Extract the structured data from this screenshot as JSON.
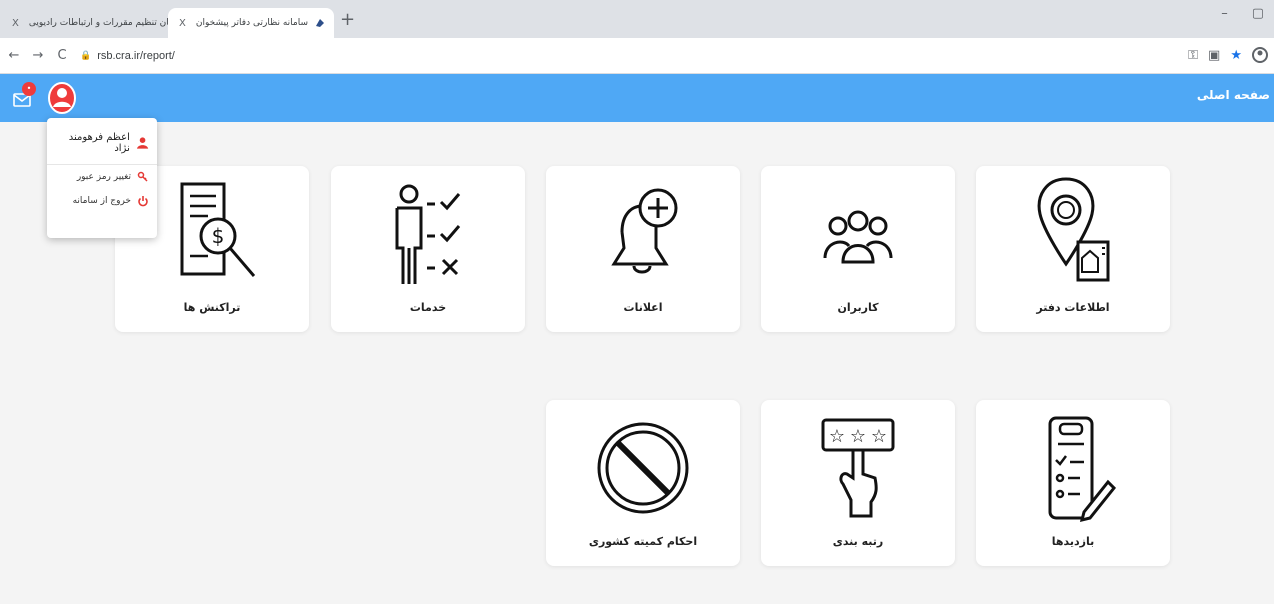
{
  "browser": {
    "tabs": [
      {
        "title": "سازمان تنظیم مقررات و ارتباطات رادیویی",
        "close": "X",
        "active": false
      },
      {
        "title": "سامانه نظارتی دفاتر پیشخوان",
        "close": "X",
        "active": true
      }
    ],
    "new_tab": "+",
    "window_controls": {
      "minimize": "–",
      "restore": "▢"
    },
    "url": "rsb.cra.ir/report/",
    "nav": {
      "back": "←",
      "forward": "→",
      "reload": "C"
    }
  },
  "appbar": {
    "home_label": "صفحه اصلی",
    "mail_badge": "•",
    "color": "#4fa8f5"
  },
  "user_menu": {
    "user_name": "اعظم فرهومند نژاد",
    "items": [
      {
        "label": "تغییر رمز عبور",
        "icon": "key-icon"
      },
      {
        "label": "خروج از سامانه",
        "icon": "power-icon"
      }
    ]
  },
  "cards": [
    {
      "key": "office-info",
      "label": "اطلاعات دفتر",
      "icon": "location-building-icon"
    },
    {
      "key": "users",
      "label": "کاربران",
      "icon": "users-group-icon"
    },
    {
      "key": "notifications",
      "label": "اعلانات",
      "icon": "bell-plus-icon"
    },
    {
      "key": "services",
      "label": "خدمات",
      "icon": "person-checklist-icon"
    },
    {
      "key": "transactions",
      "label": "تراکنش ها",
      "icon": "document-dollar-search-icon"
    },
    {
      "key": "visits",
      "label": "بازدیدها",
      "icon": "checklist-pencil-icon"
    },
    {
      "key": "ranking",
      "label": "رتبه بندی",
      "icon": "stars-hand-icon"
    },
    {
      "key": "rulings",
      "label": "احکام کمیته کشوری",
      "icon": "prohibited-icon"
    }
  ],
  "colors": {
    "accent": "#4fa8f5",
    "badge": "#ef3b3b",
    "menu_icon": "#e53935"
  }
}
